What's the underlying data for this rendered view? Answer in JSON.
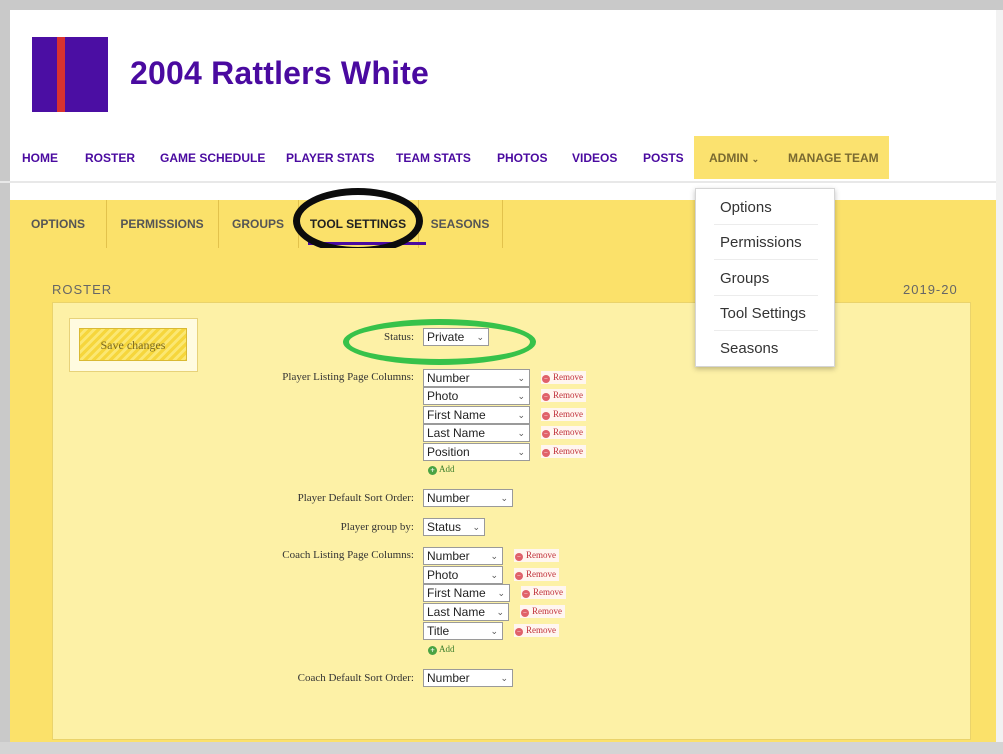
{
  "team": {
    "title": "2004 Rattlers White"
  },
  "main_nav": {
    "items": [
      "HOME",
      "ROSTER",
      "GAME SCHEDULE",
      "PLAYER STATS",
      "TEAM STATS",
      "PHOTOS",
      "VIDEOS",
      "POSTS"
    ],
    "admin_label": "ADMIN",
    "admin_caret": "⌄",
    "manage_label": "MANAGE TEAM"
  },
  "admin_menu": {
    "items": [
      "Options",
      "Permissions",
      "Groups",
      "Tool Settings",
      "Seasons"
    ]
  },
  "sub_nav": {
    "tabs": [
      "OPTIONS",
      "PERMISSIONS",
      "GROUPS",
      "TOOL SETTINGS",
      "SEASONS"
    ],
    "active": "TOOL SETTINGS"
  },
  "section": {
    "title": "ROSTER",
    "season": "2019-20"
  },
  "save_button": {
    "label": "Save changes"
  },
  "form": {
    "status": {
      "label": "Status:",
      "value": "Private"
    },
    "player_columns": {
      "label": "Player Listing Page Columns:",
      "values": [
        "Number",
        "Photo",
        "First Name",
        "Last Name",
        "Position"
      ]
    },
    "player_sort": {
      "label": "Player Default Sort Order:",
      "value": "Number"
    },
    "player_group": {
      "label": "Player group by:",
      "value": "Status"
    },
    "coach_columns": {
      "label": "Coach Listing Page Columns:",
      "values": [
        "Number",
        "Photo",
        "First Name",
        "Last Name",
        "Title"
      ]
    },
    "coach_sort": {
      "label": "Coach Default Sort Order:",
      "value": "Number"
    },
    "remove_label": "Remove",
    "add_label": "Add"
  },
  "annotations": {
    "black_oval_target": "TOOL SETTINGS",
    "green_oval_target": "Status"
  },
  "colors": {
    "brand_purple": "#4a0aa0",
    "brand_red": "#d9322f",
    "page_yellow": "#fbe16a",
    "annotation_black": "#0c0c0c",
    "annotation_green": "#37c24a"
  },
  "icons": {
    "select_chevron": "chevron-down-icon",
    "remove": "remove-circle-icon",
    "add": "add-circle-icon"
  }
}
